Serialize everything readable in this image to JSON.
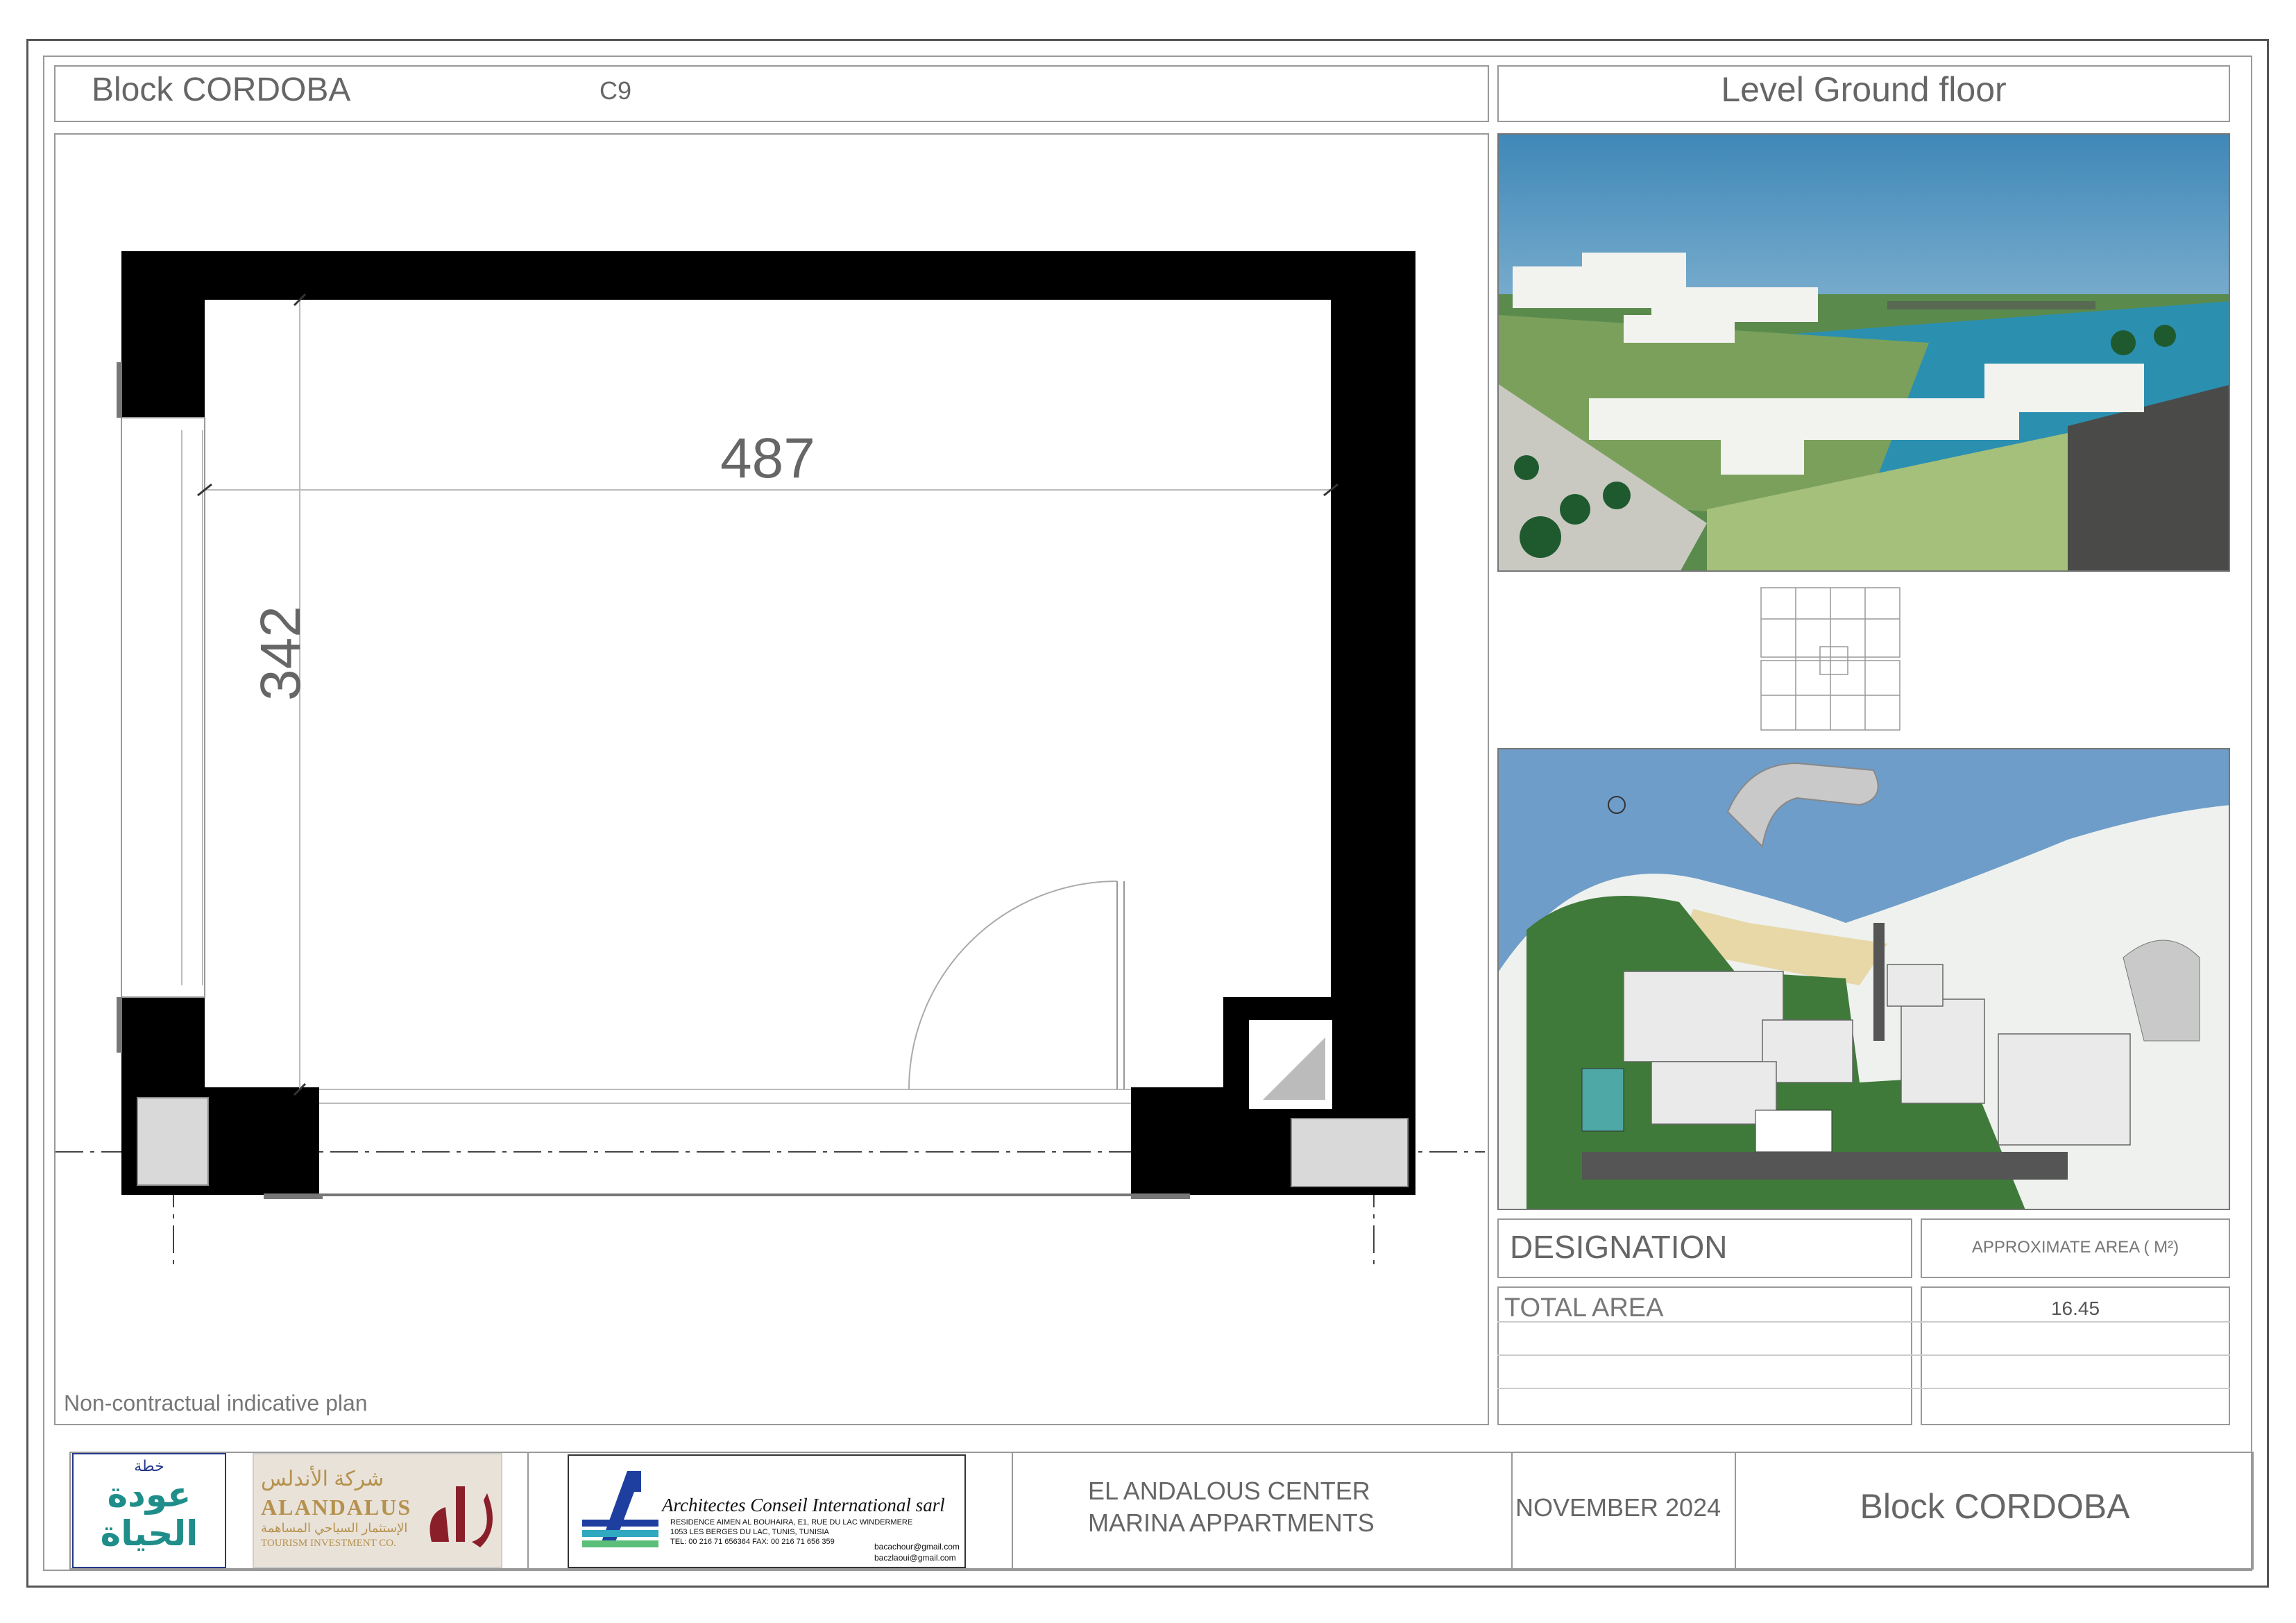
{
  "header": {
    "block_title": "Block CORDOBA",
    "unit_code": "C9",
    "level": "Level Ground floor"
  },
  "plan": {
    "width_dim": "487",
    "height_dim": "342",
    "disclaimer": "Non-contractual indicative plan"
  },
  "area_table": {
    "designation_header": "DESIGNATION",
    "area_header": "APPROXIMATE AREA  ( M²)",
    "rows": [
      {
        "label": "TOTAL AREA",
        "value": "16.45"
      }
    ]
  },
  "title_block": {
    "logo1_arabic_small": "خطة",
    "logo1_arabic": "عودة الحياة",
    "logo2_arabic": "شركة الأندلس",
    "logo2_name": "ALANDALUS",
    "logo2_arabic_sub": "الإستثمار السياحي المساهمة",
    "logo2_sub": "TOURISM INVESTMENT CO.",
    "architect_name": "Architectes  Conseil  International sarl",
    "architect_address1": "RESIDENCE AIMEN AL BOUHAIRA, E1, RUE DU LAC WINDERMERE",
    "architect_address2": "1053 LES BERGES DU LAC, TUNIS, TUNISIA",
    "architect_tel": "TEL: 00 216 71 656364   FAX: 00 216 71 656 359",
    "architect_email1": "bacachour@gmail.com",
    "architect_email2": "baczlaoui@gmail.com",
    "project_line1": "EL ANDALOUS CENTER",
    "project_line2": "MARINA APPARTMENTS",
    "date": "NOVEMBER 2024",
    "block": "Block  CORDOBA"
  },
  "colors": {
    "wall": "#000000",
    "frame": "#555555",
    "logo_teal": "#1f8e8a",
    "logo_navy": "#23378a",
    "logo_red": "#8a1f2a",
    "logo_gold": "#b5914e",
    "architect_blue": "#1e3fa0"
  }
}
